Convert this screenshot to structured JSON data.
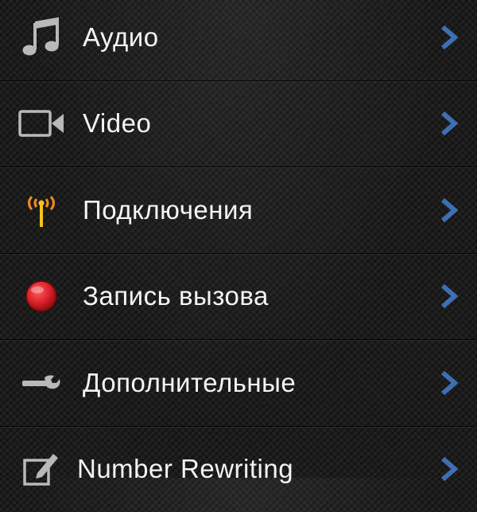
{
  "menu": {
    "items": [
      {
        "label": "Аудио",
        "icon": "music-note-icon"
      },
      {
        "label": "Video",
        "icon": "video-camera-icon"
      },
      {
        "label": "Подключения",
        "icon": "antenna-icon"
      },
      {
        "label": "Запись вызова",
        "icon": "record-icon"
      },
      {
        "label": "Дополнительные",
        "icon": "wrench-icon"
      },
      {
        "label": "Number Rewriting",
        "icon": "edit-icon"
      }
    ]
  },
  "colors": {
    "chevron": "#3e6fb5",
    "record": "#d8202a",
    "antenna_orange": "#f28c1e",
    "antenna_yellow": "#f7c21c",
    "icon_gray": "#b9b9b9"
  }
}
